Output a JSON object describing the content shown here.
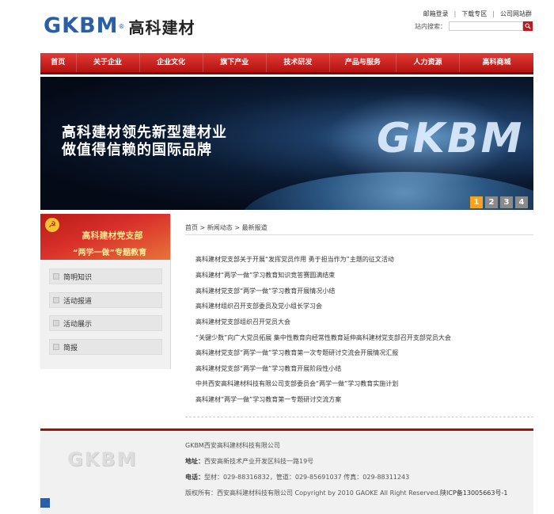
{
  "brand": {
    "logo_latin": "GKBM",
    "logo_reg": "®",
    "logo_cn": "高科建材"
  },
  "toplinks": [
    "邮箱登录",
    "下载专区",
    "公司网站群"
  ],
  "search": {
    "label": "站内搜索：",
    "placeholder": ""
  },
  "nav": [
    "首页",
    "关于企业",
    "企业文化",
    "旗下产业",
    "技术研发",
    "产品与服务",
    "人力资源",
    "高科商城"
  ],
  "banner": {
    "line1": "高科建材领先新型建材业",
    "line2": "做值得信赖的国际品牌",
    "mark": "GKBM",
    "slides": [
      "1",
      "2",
      "3",
      "4"
    ],
    "active_slide": 0
  },
  "sidebar": {
    "party_title": "高科建材党支部",
    "party_sub": "“两学一做”专题教育",
    "items": [
      "简明知识",
      "活动报道",
      "活动展示",
      "简报"
    ]
  },
  "breadcrumb": {
    "home": "首页",
    "sep": ">",
    "level1": "新闻动态",
    "level2": "最新报道"
  },
  "news": [
    "高科建材党支部关于开展“发挥党员作用 勇于担当作为”主题的征文活动",
    "高科建材“两学一做”学习教育知识竞答赛圆满结束",
    "高科建材党支部“两学一做”学习教育开展情况小结",
    "高科建材组织召开支部委员及党小组长学习会",
    "高科建材党支部组织召开党员大会",
    "“关键少数”向广大党员拓展 集中性教育向经常性教育延伸高科建材党支部召开支部党员大会",
    "高科建材党支部“两学一做”学习教育第一次专题研讨交流会开展情况汇报",
    "高科建材党支部“两学一做”学习教育开展阶段性小结",
    "中共西安高科建材科技有限公司支部委员会“两学一做”学习教育实施计划",
    "高科建材“两学一做”学习教育第一专题研讨交流方案"
  ],
  "footer": {
    "logo": "GKBM",
    "company": "GKBM西安高科建材科技有限公司",
    "address_label": "地址：",
    "address": "西安高新技术产业开发区科技一路19号",
    "phone_label": "电话：",
    "phone": "型材：029-88316832，管道：029-85691037 传真：029-88311243",
    "copyright_label": "版权所有：",
    "copyright": "西安高科建材科技有限公司 Copyright by 2010 GAOKE All Right Reserved.",
    "icp": "陕ICP备13005663号-1",
    "badge": "🐾"
  }
}
